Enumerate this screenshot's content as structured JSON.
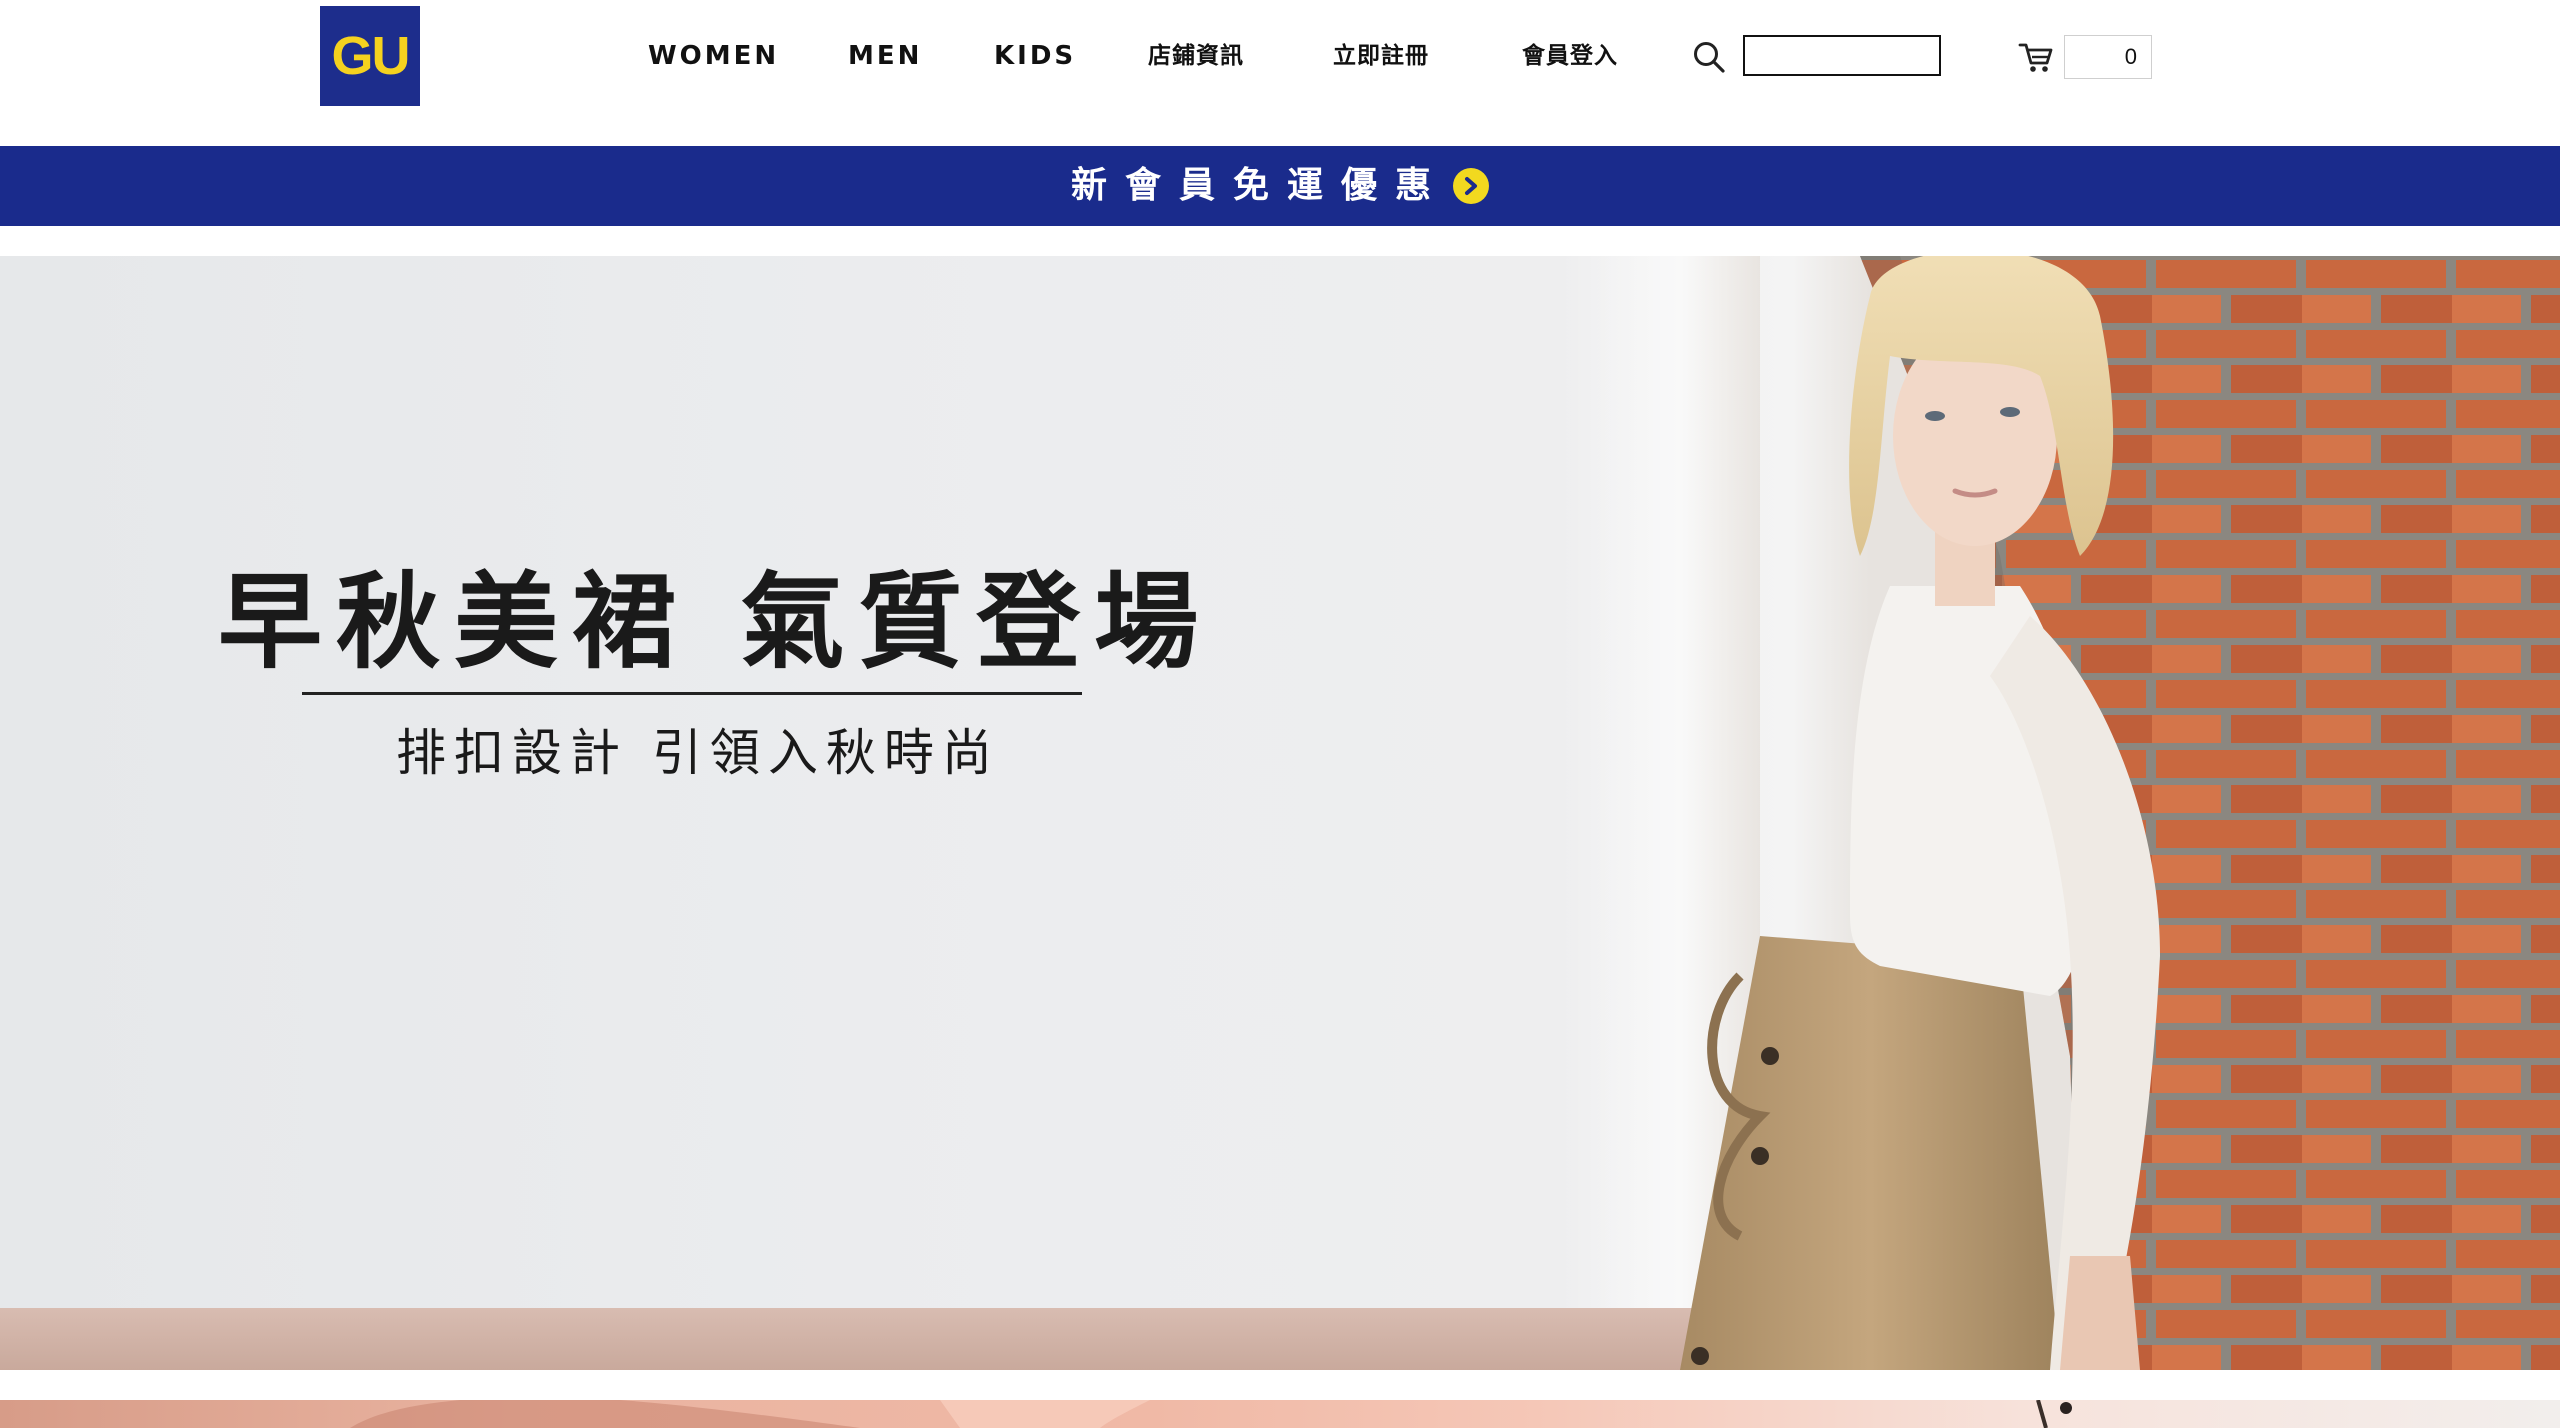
{
  "brand": {
    "logo_text": "GU",
    "primary_color": "#1d2d8c",
    "accent_color": "#f5d21f"
  },
  "nav": {
    "items": [
      {
        "label": "WOMEN"
      },
      {
        "label": "MEN"
      },
      {
        "label": "KIDS"
      },
      {
        "label": "店鋪資訊"
      },
      {
        "label": "立即註冊"
      },
      {
        "label": "會員登入"
      }
    ]
  },
  "search": {
    "icon": "search-icon",
    "value": "",
    "placeholder": ""
  },
  "cart": {
    "icon": "cart-icon",
    "count": "0"
  },
  "promo": {
    "text": "新會員免運優惠",
    "icon": "chevron-right-circle-icon",
    "background": "#1a2b8c",
    "icon_color": "#f2d91f"
  },
  "hero": {
    "title": "早秋美裙 氣質登場",
    "subtitle": "排扣設計 引領入秋時尚"
  }
}
